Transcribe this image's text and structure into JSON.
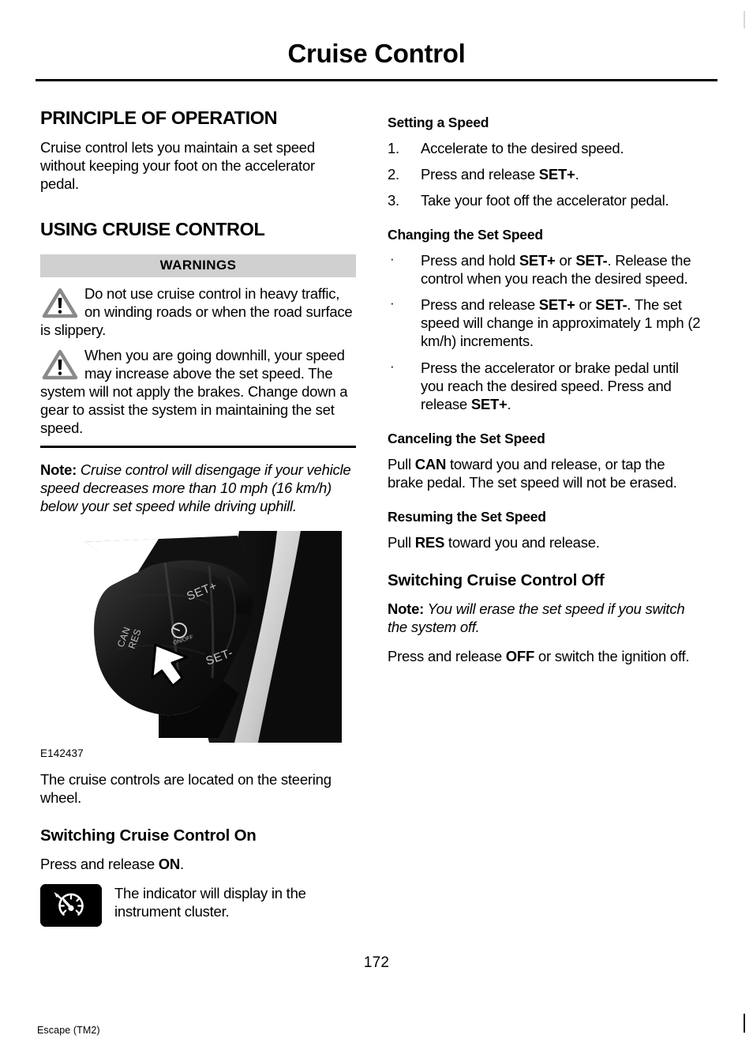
{
  "document": {
    "chapter_title": "Cruise Control",
    "page_number": "172",
    "footer_model": "Escape (TM2)"
  },
  "left_column": {
    "section_1": {
      "heading": "PRINCIPLE OF OPERATION",
      "paragraph": "Cruise control lets you maintain a set speed without keeping your foot on the accelerator pedal."
    },
    "section_2": {
      "heading": "USING CRUISE CONTROL",
      "warnings": {
        "bar_label": "WARNINGS",
        "items": [
          "Do not use cruise control in heavy traffic, on winding roads or when the road surface is slippery.",
          "When you are going downhill, your speed may increase above the set speed. The system will not apply the brakes. Change down a gear to assist the system in maintaining the set speed."
        ]
      },
      "note": {
        "lead": "Note:",
        "text": "Cruise control will disengage if your vehicle speed decreases more than 10 mph (16 km/h) below your set speed while driving uphill."
      },
      "figure": {
        "caption": "E142437",
        "alt": "cruise-control-stalk-photo",
        "labels": {
          "set_plus": "SET+",
          "set_minus": "SET-",
          "can": "CAN",
          "res": "RES",
          "on_off": "ON/OFF"
        }
      },
      "figure_text": "The cruise controls are located on the steering wheel."
    },
    "section_3": {
      "heading": "Switching Cruise Control On",
      "instruction_prefix": "Press and release ",
      "instruction_button": "ON",
      "instruction_suffix": ".",
      "indicator_text": "The indicator will display in the instrument cluster."
    }
  },
  "right_column": {
    "setting_a_speed": {
      "heading": "Setting a Speed",
      "steps": [
        {
          "num": "1.",
          "prefix": "Accelerate to the desired speed.",
          "bold": "",
          "suffix": ""
        },
        {
          "num": "2.",
          "prefix": "Press and release ",
          "bold": "SET+",
          "suffix": "."
        },
        {
          "num": "3.",
          "prefix": "Take your foot off the accelerator pedal.",
          "bold": "",
          "suffix": ""
        }
      ]
    },
    "changing_the_set_speed": {
      "heading": "Changing the Set Speed",
      "bullet_char": "·",
      "items": [
        {
          "p1": "Press and hold ",
          "b1": "SET+",
          "p2": " or ",
          "b2": "SET-",
          "p3": ". Release the control when you reach the desired speed."
        },
        {
          "p1": "Press and release ",
          "b1": "SET+",
          "p2": " or ",
          "b2": "SET-",
          "p3": ". The set speed will change in approximately 1 mph (2 km/h) increments."
        },
        {
          "p1": "Press the accelerator or brake pedal until you reach the desired speed. Press and release ",
          "b1": "SET+",
          "p2": ".",
          "b2": "",
          "p3": ""
        }
      ]
    },
    "canceling_the_set_speed": {
      "heading": "Canceling the Set Speed",
      "p1": "Pull ",
      "b1": "CAN",
      "p2": " toward you and release, or tap the brake pedal. The set speed will not be erased."
    },
    "resuming_the_set_speed": {
      "heading": "Resuming the Set Speed",
      "p1": "Pull ",
      "b1": "RES",
      "p2": " toward you and release."
    },
    "switching_cruise_control_off": {
      "heading": "Switching Cruise Control Off",
      "note_lead": "Note:",
      "note_text": "You will erase the set speed if you switch the system off.",
      "p1": "Press and release ",
      "b1": "OFF",
      "p2": " or switch the ignition off."
    }
  },
  "colors": {
    "warning_bar_bg": "#d0d0d0",
    "rule": "#000000",
    "text": "#000000",
    "icon_dark": "#000000",
    "warning_triangle": "#8a8a8a"
  }
}
